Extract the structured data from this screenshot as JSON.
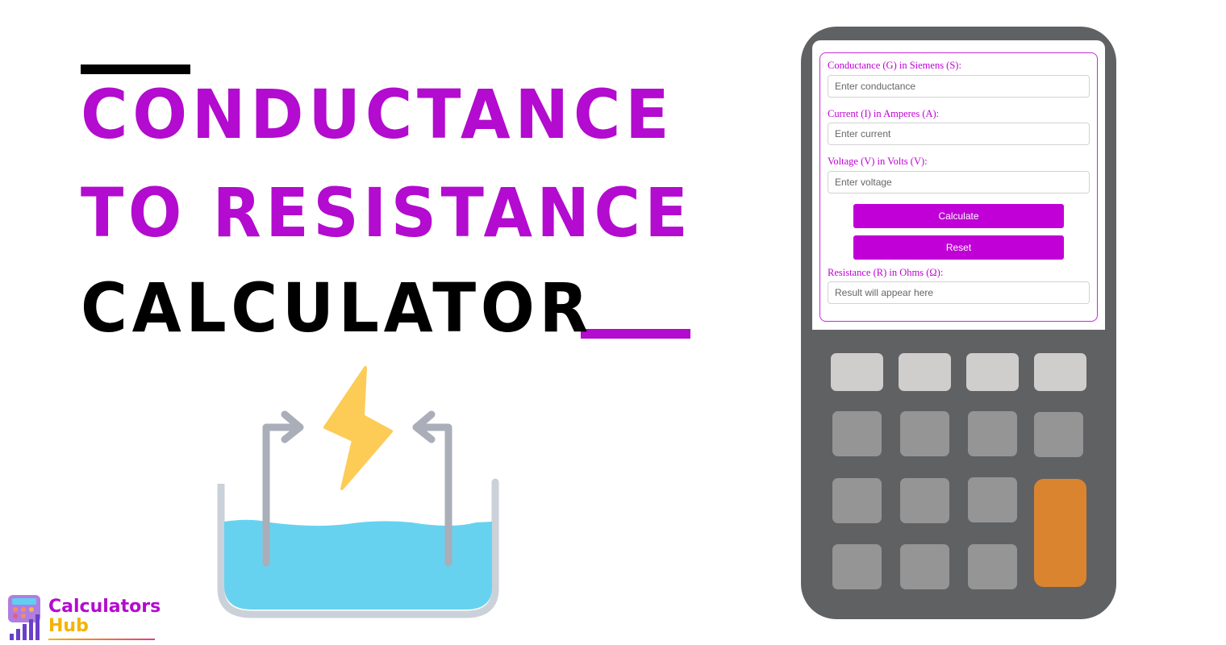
{
  "headline": {
    "line1": "Conductance",
    "line2": "to Resistance",
    "line3": "Calculator"
  },
  "colors": {
    "accent": "#b30bcf",
    "button": "#c000d6",
    "device_body": "#606163",
    "key_light": "#cfcecc",
    "key_mid": "#959595",
    "key_orange": "#db8430",
    "water": "#67d2ef",
    "bolt": "#fdcc57",
    "electrode": "#a9aeb8"
  },
  "calculator": {
    "fields": [
      {
        "label": "Conductance (G) in Siemens (S):",
        "placeholder": "Enter conductance",
        "value": ""
      },
      {
        "label": "Current (I) in Amperes (A):",
        "placeholder": "Enter current",
        "value": ""
      },
      {
        "label": "Voltage (V) in Volts (V):",
        "placeholder": "Enter voltage",
        "value": ""
      }
    ],
    "calculate_label": "Calculate",
    "reset_label": "Reset",
    "result": {
      "label": "Resistance (R) in Ohms (Ω):",
      "placeholder": "Result will appear here",
      "value": ""
    }
  },
  "illustration": {
    "icons": [
      "beaker-icon",
      "lightning-bolt-icon",
      "electrode-arrow-left-icon",
      "electrode-arrow-right-icon"
    ]
  },
  "logo": {
    "line1": "Calculators",
    "line2": "Hub"
  }
}
